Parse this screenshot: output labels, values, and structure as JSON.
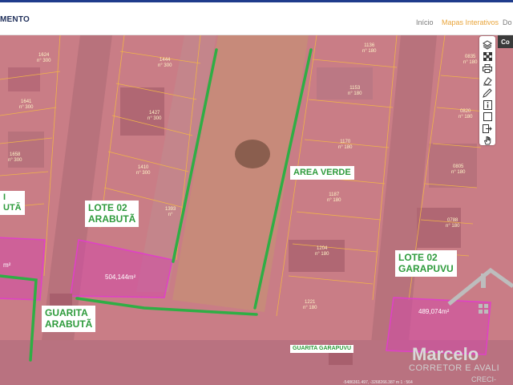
{
  "header": {
    "brand": "MENTO",
    "nav": [
      {
        "label": "Início"
      },
      {
        "label": "Mapas Interativos"
      },
      {
        "label": "Do"
      }
    ]
  },
  "panel_button": "Co",
  "labels": {
    "lote_arabuta_left": "LOTE 02\nARABUTÃ",
    "lote_arabuta_left_partial": "I\nUTÃ",
    "area_verde": "AREA VERDE",
    "lote_garapuvu": "LOTE 02\nGARAPUVU",
    "guarita_arabuta": "GUARITA\nARABUTÃ",
    "guarita_garapuvu": "GUARITA GARAPUVU"
  },
  "areas": {
    "arabuta": "504,144m²",
    "garapuvu": "489,074m²",
    "left_partial": "m²"
  },
  "lots": [
    {
      "id": "1624",
      "text": "1624\nn° 300"
    },
    {
      "id": "1444",
      "text": "1444\nn° 300"
    },
    {
      "id": "1641",
      "text": "1641\nn° 300"
    },
    {
      "id": "1427",
      "text": "1427\nn° 300"
    },
    {
      "id": "1658",
      "text": "1658\nn° 300"
    },
    {
      "id": "1410",
      "text": "1410\nn° 300"
    },
    {
      "id": "1393",
      "text": "1393\nn°"
    },
    {
      "id": "1136",
      "text": "1136\nn° 180"
    },
    {
      "id": "1153",
      "text": "1153\nn° 180"
    },
    {
      "id": "1170",
      "text": "1170\nn° 180"
    },
    {
      "id": "1187",
      "text": "1187\nn° 180"
    },
    {
      "id": "1204",
      "text": "1204\nn° 180"
    },
    {
      "id": "1221",
      "text": "1221\nn° 180"
    },
    {
      "id": "0835",
      "text": "0835\nn° 180"
    },
    {
      "id": "0820",
      "text": "0820\nn° 180"
    },
    {
      "id": "0805",
      "text": "0805\nn° 180"
    },
    {
      "id": "0788",
      "text": "0788\nn° 180"
    }
  ],
  "toolbar": [
    {
      "icon": "layers-icon"
    },
    {
      "icon": "checkerboard-icon"
    },
    {
      "icon": "print-icon"
    },
    {
      "icon": "eraser-icon"
    },
    {
      "icon": "pencil-icon"
    },
    {
      "icon": "info-icon"
    },
    {
      "icon": "square-icon"
    },
    {
      "icon": "export-icon"
    },
    {
      "icon": "hand-icon"
    }
  ],
  "watermark": {
    "name": "Marcelo",
    "subtitle": "CORRETOR E AVALI",
    "creci": "CRECI-"
  },
  "scale_text": "-5486361.497, -3268266.387 m  1 : 564",
  "colors": {
    "overlay": "#c97d86",
    "lot_lines": "#f0b34a",
    "green_line": "#2fae45",
    "highlight_lot": "#e040c8",
    "label_text": "#2e9b3c",
    "nav_active": "#e9a53b"
  }
}
